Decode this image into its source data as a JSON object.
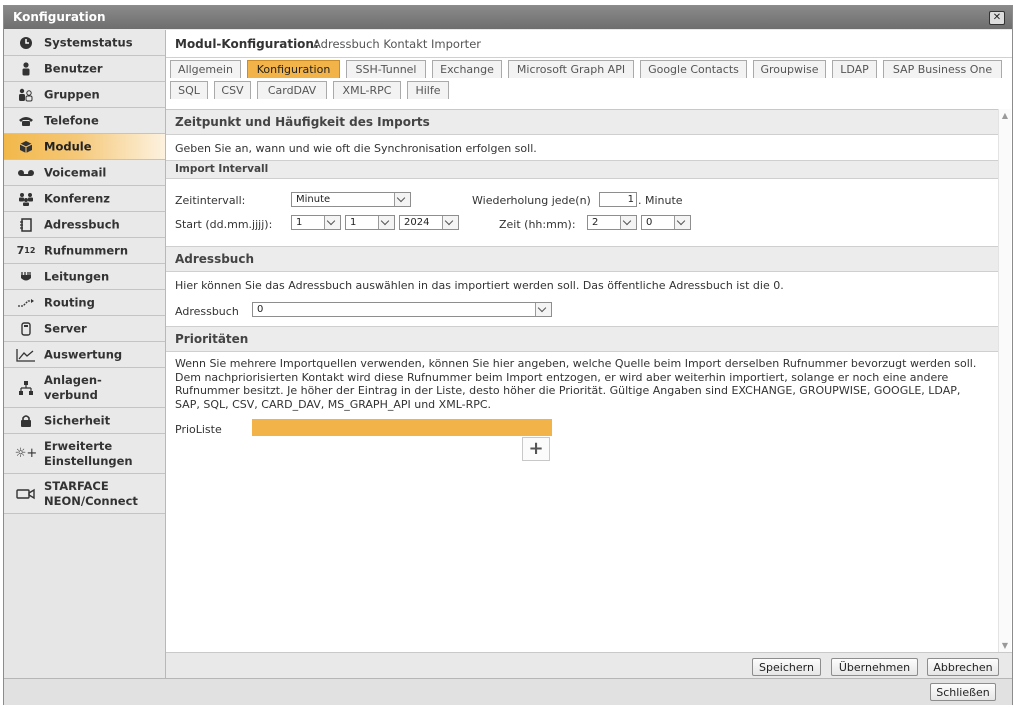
{
  "window": {
    "title": "Konfiguration"
  },
  "sidebar": {
    "items": [
      {
        "label": "Systemstatus",
        "icon": "clock-icon"
      },
      {
        "label": "Benutzer",
        "icon": "user-icon"
      },
      {
        "label": "Gruppen",
        "icon": "group-icon"
      },
      {
        "label": "Telefone",
        "icon": "phone-icon"
      },
      {
        "label": "Module",
        "icon": "cube-icon",
        "active": true
      },
      {
        "label": "Voicemail",
        "icon": "voicemail-icon"
      },
      {
        "label": "Konferenz",
        "icon": "conference-icon"
      },
      {
        "label": "Adressbuch",
        "icon": "addressbook-icon"
      },
      {
        "label": "Rufnummern",
        "icon": "numbers-icon"
      },
      {
        "label": "Leitungen",
        "icon": "plug-icon"
      },
      {
        "label": "Routing",
        "icon": "routing-icon"
      },
      {
        "label": "Server",
        "icon": "server-icon"
      },
      {
        "label": "Auswertung",
        "icon": "chart-icon"
      },
      {
        "label_line1": "Anlagen-",
        "label_line2": "verbund",
        "icon": "network-icon"
      },
      {
        "label": "Sicherheit",
        "icon": "lock-icon"
      },
      {
        "label_line1": "Erweiterte",
        "label_line2": "Einstellungen",
        "icon": "gear-plus-icon"
      },
      {
        "label_line1": "STARFACE",
        "label_line2": "NEON/Connect",
        "icon": "video-icon"
      }
    ]
  },
  "module": {
    "heading_label": "Modul-Konfiguration:",
    "heading_value": "Adressbuch Kontakt Importer"
  },
  "tabs": {
    "row1": [
      "Allgemein",
      "Konfiguration",
      "SSH-Tunnel",
      "Exchange",
      "Microsoft Graph API",
      "Google Contacts",
      "Groupwise",
      "LDAP",
      "SAP Business One"
    ],
    "row2": [
      "SQL",
      "CSV",
      "CardDAV",
      "XML-RPC",
      "Hilfe"
    ],
    "active": "Konfiguration"
  },
  "sections": {
    "import_time": {
      "title": "Zeitpunkt und Häufigkeit des Imports",
      "description": "Geben Sie an, wann und wie oft die Synchronisation erfolgen soll."
    },
    "import_interval": {
      "title": "Import Intervall",
      "interval_label": "Zeitintervall:",
      "interval_value": "Minute",
      "repeat_label": "Wiederholung jede(n)",
      "repeat_value": "1",
      "repeat_unit": ". Minute",
      "start_label": "Start (dd.mm.jjjj):",
      "start_day": "1",
      "start_month": "1",
      "start_year": "2024",
      "time_label": "Zeit (hh:mm):",
      "time_hour": "2",
      "time_minute": "0"
    },
    "addressbook": {
      "title": "Adressbuch",
      "description": "Hier können Sie das Adressbuch auswählen in das importiert werden soll. Das öffentliche Adressbuch ist die 0.",
      "field_label": "Adressbuch",
      "field_value": "0"
    },
    "priorities": {
      "title": "Prioritäten",
      "description_line1": "Wenn Sie mehrere Importquellen verwenden, können Sie hier angeben, welche Quelle beim Import derselben Rufnummer bevorzugt werden soll.",
      "description_line2": "Dem nachpriorisierten Kontakt wird diese Rufnummer beim Import entzogen, er wird aber weiterhin importiert, solange er noch eine andere",
      "description_line3": "Rufnummer besitzt. Je höher der Eintrag in der Liste, desto höher die Priorität. Gültige Angaben sind EXCHANGE, GROUPWISE, GOOGLE, LDAP,",
      "description_line4": "SAP, SQL, CSV, CARD_DAV, MS_GRAPH_API und XML-RPC.",
      "list_label": "PrioListe",
      "add_icon": "plus-icon"
    }
  },
  "footer": {
    "save": "Speichern",
    "apply": "Übernehmen",
    "cancel": "Abbrechen"
  },
  "window_footer": {
    "close": "Schließen"
  },
  "colors": {
    "accent": "#f2b448"
  }
}
